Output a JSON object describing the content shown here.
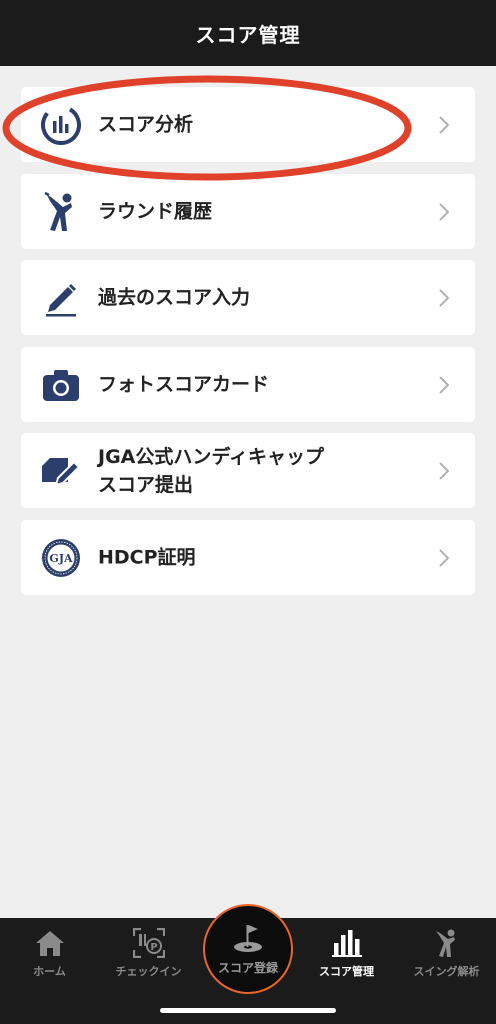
{
  "header": {
    "title": "スコア管理"
  },
  "menu": {
    "items": [
      {
        "label": "スコア分析",
        "icon": "score-analysis-icon"
      },
      {
        "label": "ラウンド履歴",
        "icon": "golfer-icon"
      },
      {
        "label": "過去のスコア入力",
        "icon": "pencil-icon"
      },
      {
        "label": "フォトスコアカード",
        "icon": "camera-icon"
      },
      {
        "label_line1": "JGA公式ハンディキャップ",
        "label_line2": "スコア提出",
        "icon": "card-pen-icon"
      },
      {
        "label": "HDCP証明",
        "icon": "jga-seal-icon",
        "seal_text": "GJA"
      }
    ]
  },
  "highlight": {
    "color": "#e0412a",
    "target": "スコア分析"
  },
  "tabbar": {
    "tabs": [
      {
        "label": "ホーム",
        "icon": "home-icon",
        "active": false
      },
      {
        "label": "チェックイン",
        "icon": "checkin-qr-icon",
        "active": false
      },
      {
        "label": "スコア登録",
        "icon": "flag-hole-icon",
        "active": false
      },
      {
        "label": "スコア管理",
        "icon": "bar-chart-icon",
        "active": true
      },
      {
        "label": "スイング解析",
        "icon": "swing-icon",
        "active": false
      }
    ]
  },
  "colors": {
    "header_bg": "#1b1b1b",
    "icon_navy": "#2c3e6b",
    "accent_orange": "#e8652b",
    "background": "#efefef"
  }
}
